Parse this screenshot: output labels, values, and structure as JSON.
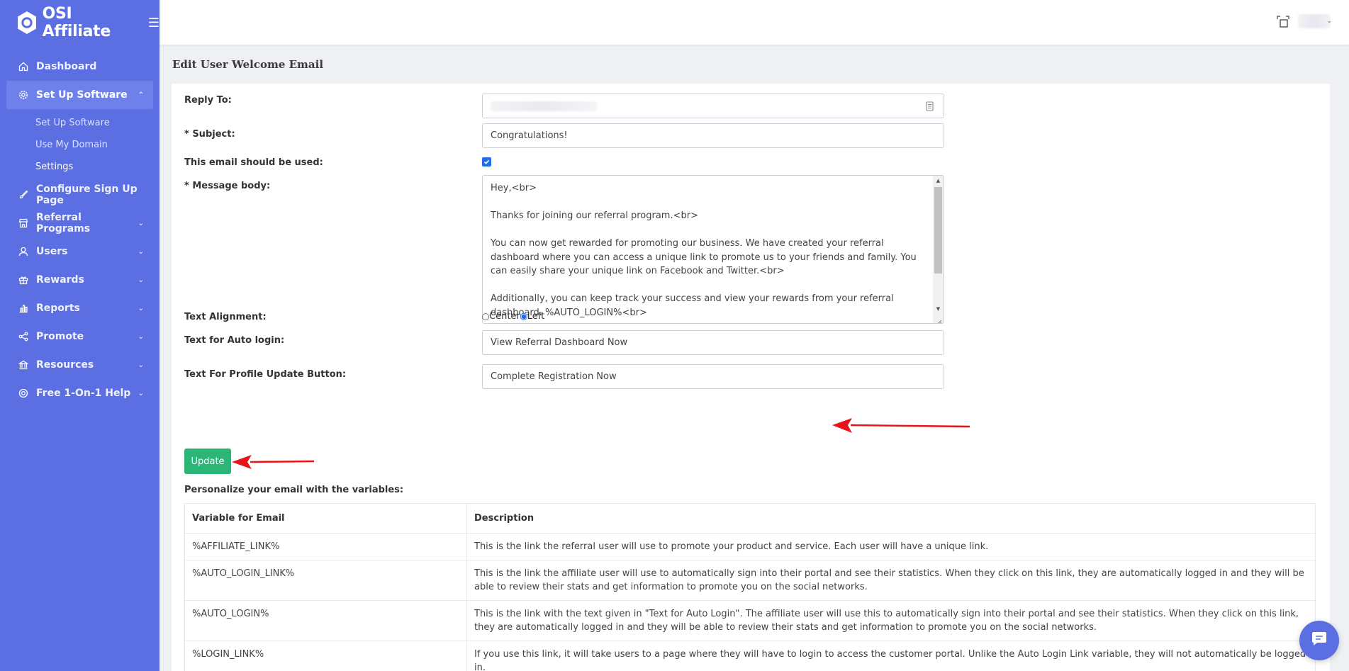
{
  "brand": {
    "name": "OSI Affiliate"
  },
  "sidebar": {
    "items": [
      {
        "label": "Dashboard",
        "icon": "home-icon"
      },
      {
        "label": "Set Up Software",
        "icon": "gear-icon",
        "active": true,
        "children": [
          "Set Up Software",
          "Use My Domain",
          "Settings"
        ]
      },
      {
        "label": "Configure Sign Up Page",
        "icon": "brush-icon"
      },
      {
        "label": "Referral Programs",
        "icon": "store-icon"
      },
      {
        "label": "Users",
        "icon": "user-icon"
      },
      {
        "label": "Rewards",
        "icon": "gift-icon"
      },
      {
        "label": "Reports",
        "icon": "bar-chart-icon"
      },
      {
        "label": "Promote",
        "icon": "share-icon"
      },
      {
        "label": "Resources",
        "icon": "bank-icon"
      },
      {
        "label": "Free 1-On-1 Help",
        "icon": "lifebuoy-icon"
      }
    ]
  },
  "page": {
    "title": "Edit User Welcome Email"
  },
  "form": {
    "reply_to_label": "Reply To:",
    "subject_label": "* Subject:",
    "subject_value": "Congratulations!",
    "used_label": "This email should be used:",
    "used_checked": true,
    "body_label": "* Message body:",
    "body_lines": [
      "Hey,<br>",
      "Thanks for joining our referral program.<br>",
      "You can now get rewarded for promoting our business. We have created your referral dashboard where you can access a unique link to promote us to your friends and family. You can easily share your unique link on Facebook and Twitter.<br>",
      "Additionally, you can keep track your success and view your rewards from your referral dashboard. %AUTO_LOGIN%<br>"
    ],
    "alignment_label": "Text Alignment:",
    "alignment_options": [
      "Center",
      "Left"
    ],
    "alignment_selected": "Left",
    "auto_login_label": "Text for Auto login:",
    "auto_login_value": "View Referral Dashboard Now",
    "profile_button_label": "Text For Profile Update Button:",
    "profile_button_value": "Complete Registration Now",
    "update_button": "Update"
  },
  "variables": {
    "title": "Personalize your email with the variables:",
    "headers": [
      "Variable for Email",
      "Description"
    ],
    "rows": [
      [
        "%AFFILIATE_LINK%",
        "This is the link the referral user will use to promote your product and service. Each user will have a unique link."
      ],
      [
        "%AUTO_LOGIN_LINK%",
        "This is the link the affiliate user will use to automatically sign into their portal and see their statistics. When they click on this link, they are automatically logged in and they will be able to review their stats and get information to promote you on the social networks."
      ],
      [
        "%AUTO_LOGIN%",
        "This is the link with the text given in \"Text for Auto Login\". The affiliate user will use this to automatically sign into their portal and see their statistics. When they click on this link, they are automatically logged in and they will be able to review their stats and get information to promote you on the social networks."
      ],
      [
        "%LOGIN_LINK%",
        "If you use this link, it will take users to a page where they will have to login to access the customer portal. Unlike the Auto Login Link variable, they will not automatically be logged in."
      ]
    ]
  },
  "colors": {
    "sidebar": "#5b6fe3",
    "accent_green": "#2bb678",
    "arrow_red": "#e8141b"
  }
}
